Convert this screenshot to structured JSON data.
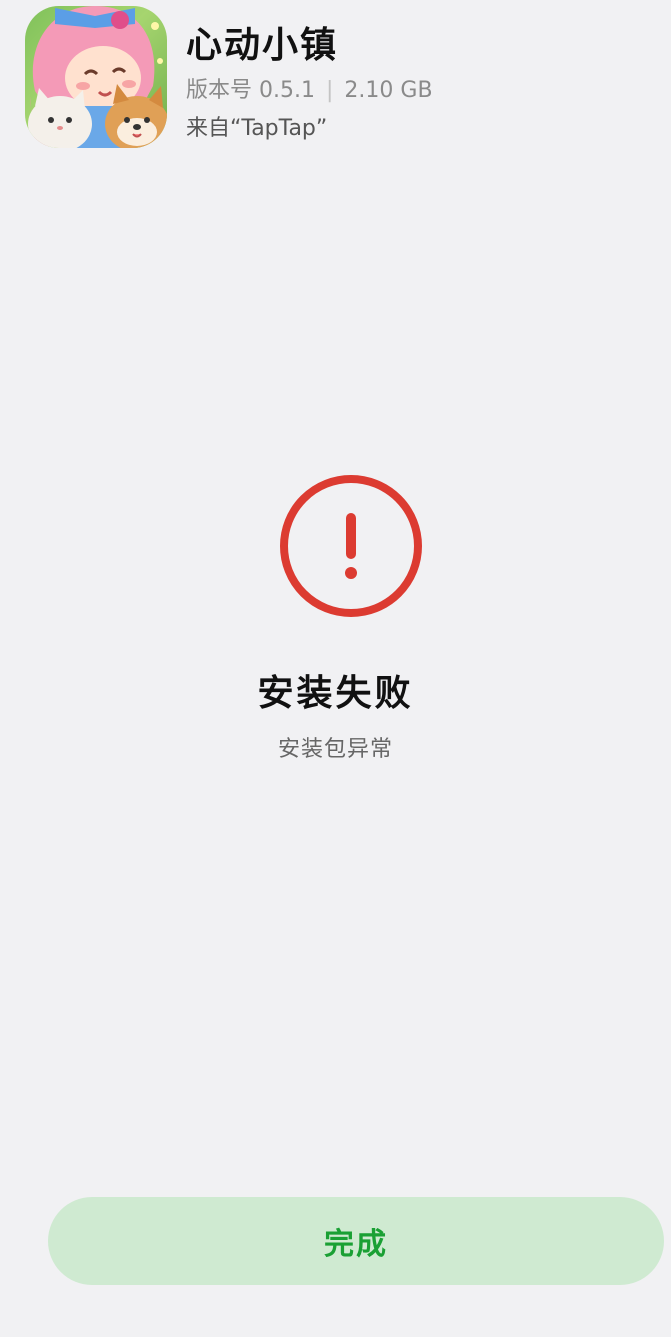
{
  "app": {
    "name": "心动小镇",
    "version_label": "版本号",
    "version": "0.5.1",
    "separator": "|",
    "size": "2.10 GB",
    "source": "来自“TapTap”"
  },
  "status": {
    "icon": "exclamation-circle-icon",
    "title": "安装失败",
    "message": "安装包异常",
    "color": "#dc3b31"
  },
  "actions": {
    "done_label": "完成",
    "done_bg": "#cfead1",
    "done_text_color": "#1aa034"
  }
}
